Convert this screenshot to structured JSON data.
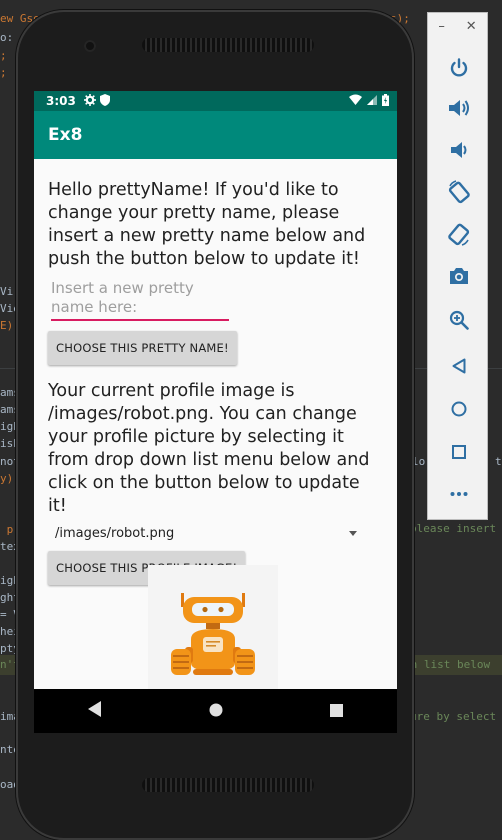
{
  "ide": {
    "fragments": [
      {
        "text": "ew Gson",
        "color": "#cc7832"
      },
      {
        "text": "s);",
        "color": "#cc7832"
      },
      {
        "text": "o: ",
        "color": "#a9b7c6"
      },
      {
        "text": ";",
        "color": "#cc7832"
      },
      {
        "text": ";",
        "color": "#cc7832"
      },
      {
        "text": "Vi",
        "color": "#a9b7c6"
      },
      {
        "text": "Vie",
        "color": "#a9b7c6"
      },
      {
        "text": "E);",
        "color": "#cc7832"
      },
      {
        "text": "ams",
        "color": "#a9b7c6"
      },
      {
        "text": "ams",
        "color": "#a9b7c6"
      },
      {
        "text": "igh",
        "color": "#a9b7c6"
      },
      {
        "text": "isE",
        "color": "#a9b7c6"
      },
      {
        "text": "not",
        "color": "#a9b7c6"
      },
      {
        "text": "y);",
        "color": "#cc7832"
      },
      {
        "text": " pr",
        "color": "#cc7832"
      },
      {
        "text": "tex",
        "color": "#a9b7c6"
      },
      {
        "text": "igh",
        "color": "#a9b7c6"
      },
      {
        "text": "ght",
        "color": "#a9b7c6"
      },
      {
        "text": "= V",
        "color": "#a9b7c6"
      },
      {
        "text": "hei",
        "color": "#a9b7c6"
      },
      {
        "text": "pty",
        "color": "#a9b7c6"
      },
      {
        "text": "n't",
        "color": "#6a8759"
      },
      {
        "text": "ima",
        "color": "#a9b7c6"
      },
      {
        "text": "ntex",
        "color": "#a9b7c6"
      },
      {
        "text": "oad",
        "color": "#a9b7c6"
      },
      {
        "text": "lo",
        "color": "#a9b7c6"
      },
      {
        "text": "t",
        "color": "#a9b7c6"
      },
      {
        "text": "please insert",
        "color": "#6a8759"
      },
      {
        "text": "wn list below",
        "color": "#6a8759"
      },
      {
        "text": "ure by select",
        "color": "#6a8759"
      }
    ]
  },
  "status": {
    "time": "3:03"
  },
  "app": {
    "title": "Ex8",
    "greeting": "Hello prettyName! If you'd like to change your pretty name, please insert a new pretty name below and push the button below to update it!",
    "name_input": {
      "value": "",
      "placeholder": "Insert a new pretty name here:"
    },
    "name_button": "CHOOSE THIS PRETTY NAME!",
    "profile_text": "Your current profile image is /images/robot.png. You can change your profile picture by selecting it from drop down list menu below and click on the button below to update it!",
    "image_select": {
      "value": "/images/robot.png"
    },
    "image_button": "CHOOSE THIS PROFILE IMAGE!"
  },
  "colors": {
    "status_bar": "#00695c",
    "app_bar": "#00897b",
    "input_underline": "#d81b60",
    "robot_body": "#f29418",
    "robot_dark": "#e07a10"
  },
  "emulator_panel": {
    "window_controls": [
      "minimize-icon",
      "close-icon"
    ],
    "tools": [
      "power-icon",
      "volume-up-icon",
      "volume-down-icon",
      "rotate-left-icon",
      "rotate-right-icon",
      "camera-icon",
      "zoom-icon",
      "back-icon",
      "home-icon",
      "overview-icon",
      "more-icon"
    ]
  }
}
